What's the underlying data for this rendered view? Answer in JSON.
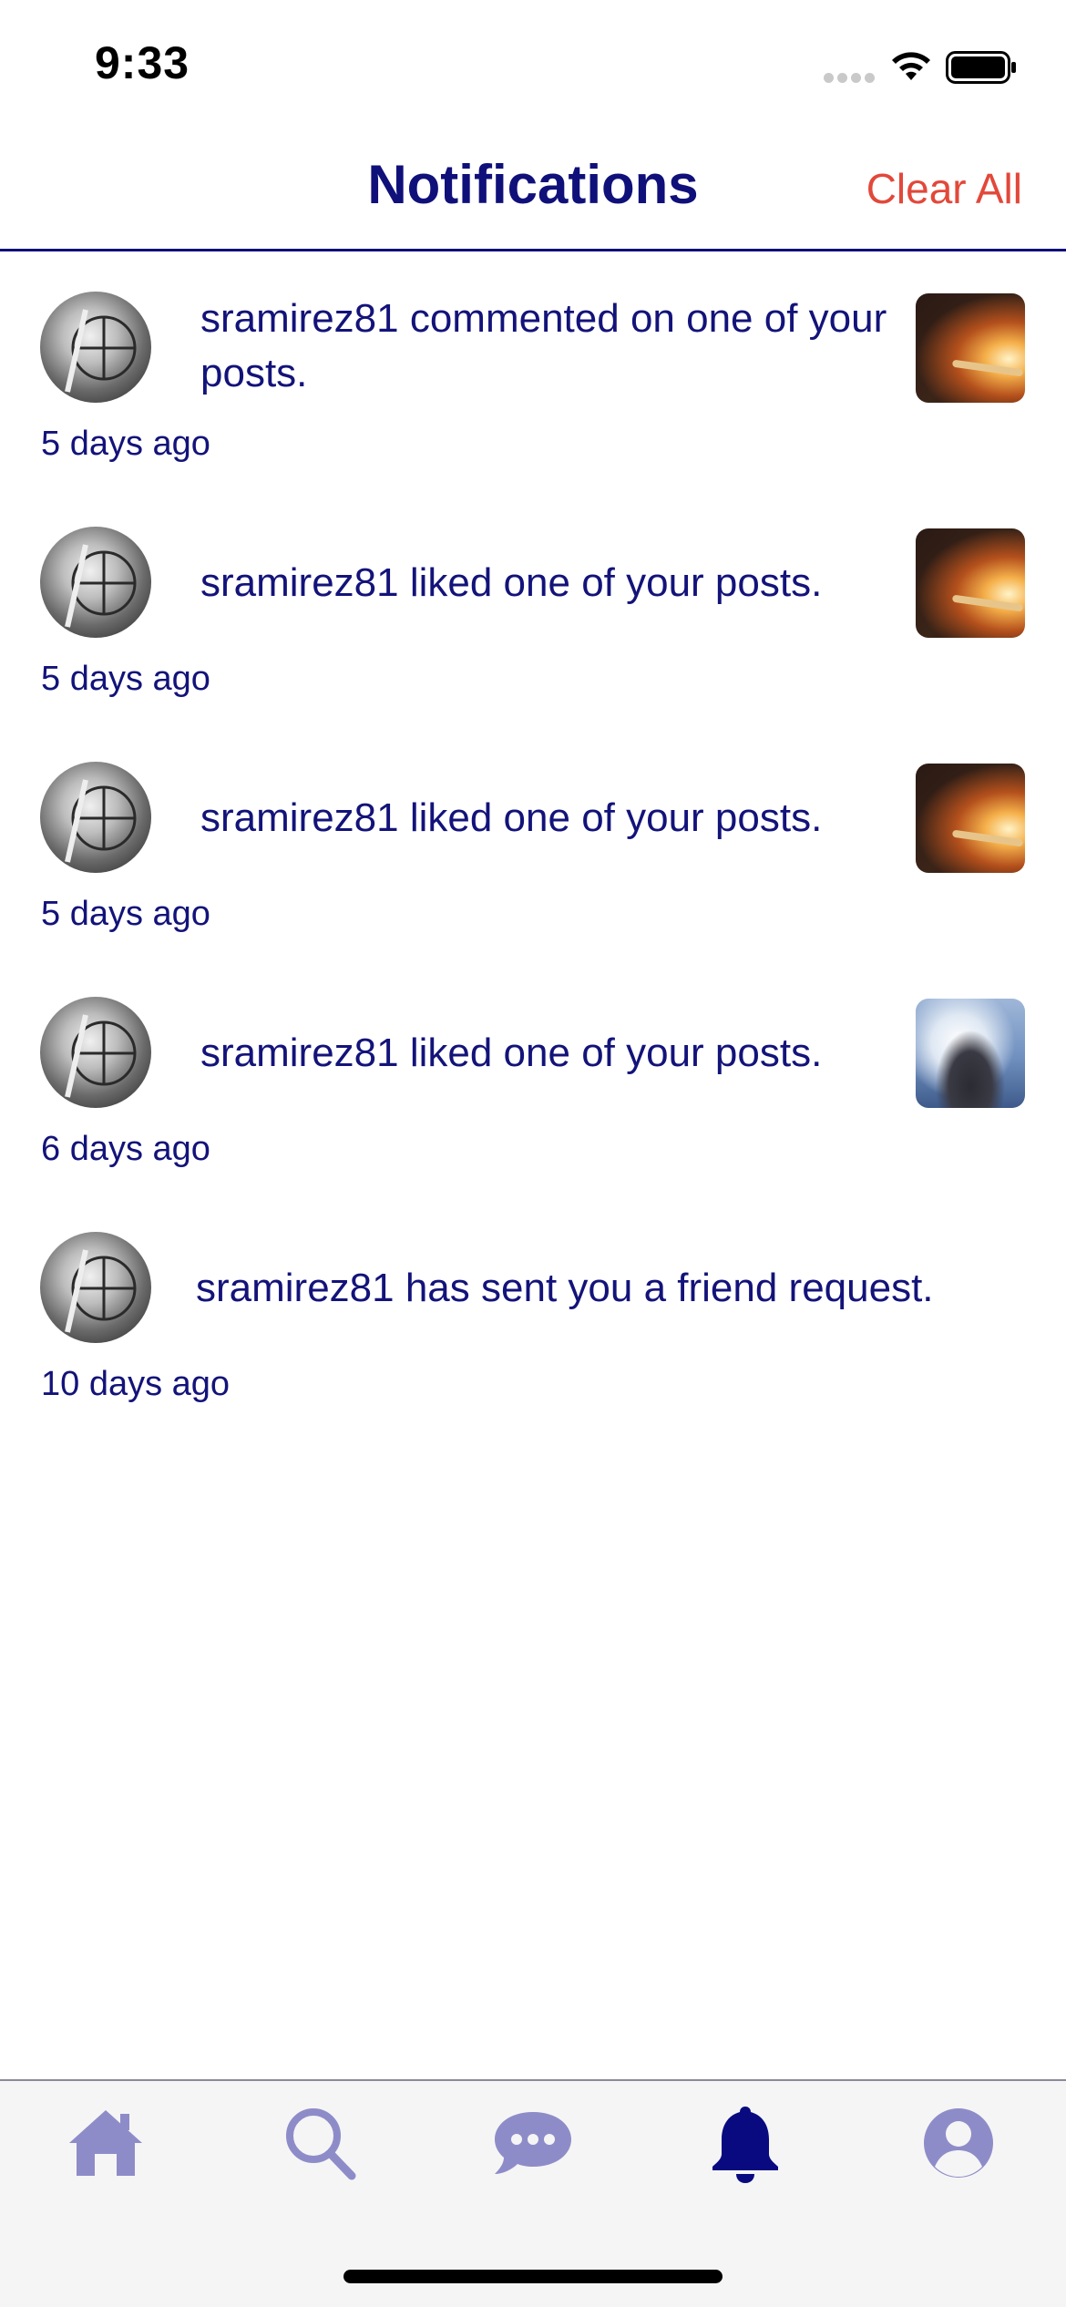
{
  "status_bar": {
    "time": "9:33"
  },
  "header": {
    "title": "Notifications",
    "clear_all": "Clear All"
  },
  "notifications": [
    {
      "text": "sramirez81 commented on one of your posts.",
      "time": "5 days ago",
      "thumbnail": "fire"
    },
    {
      "text": "sramirez81 liked one of your posts.",
      "time": "5 days ago",
      "thumbnail": "fire"
    },
    {
      "text": "sramirez81 liked one of your posts.",
      "time": "5 days ago",
      "thumbnail": "fire"
    },
    {
      "text": "sramirez81 liked one of your posts.",
      "time": "6 days ago",
      "thumbnail": "sea"
    },
    {
      "text": "sramirez81 has sent you a friend request.",
      "time": "10 days ago",
      "thumbnail": null
    }
  ],
  "tab_bar": {
    "items": [
      "home-icon",
      "search-icon",
      "chat-icon",
      "bell-icon",
      "profile-icon"
    ],
    "active": "bell-icon",
    "active_color": "#0a0a80",
    "inactive_color": "#8e8cc8"
  },
  "colors": {
    "text": "#13137a",
    "accent": "#e2483a"
  }
}
